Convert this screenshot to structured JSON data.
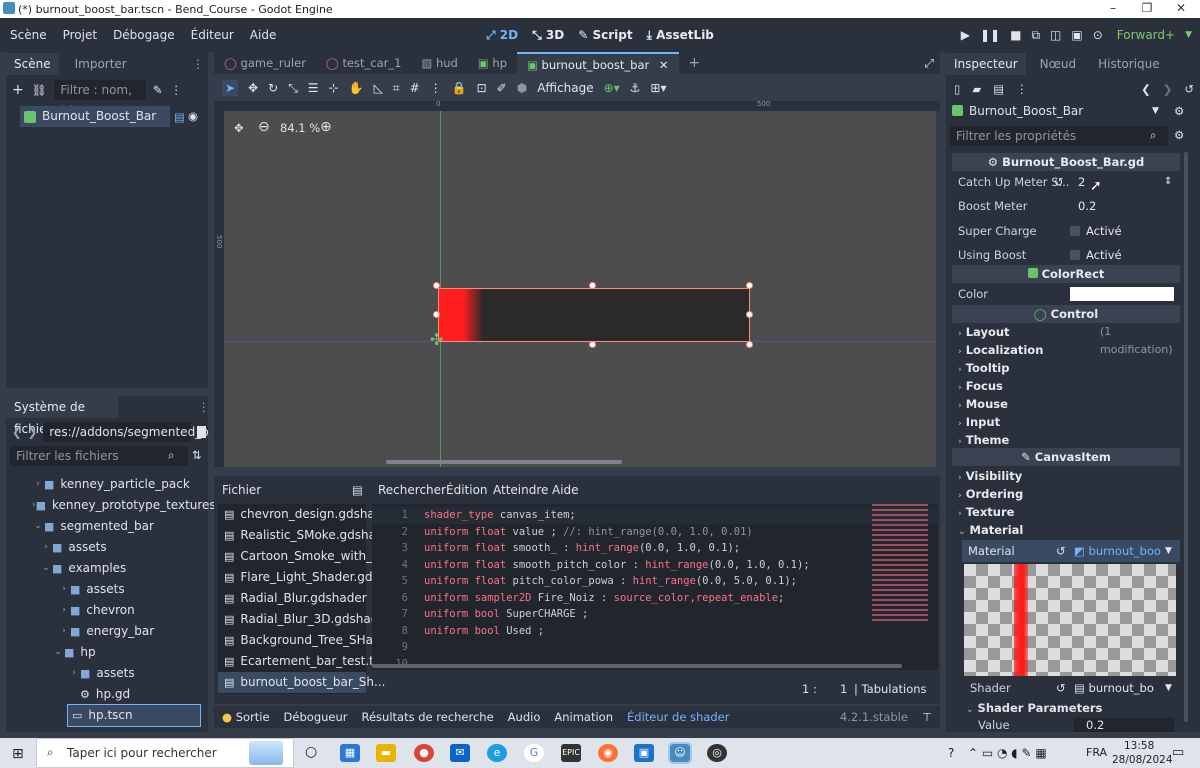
{
  "window": {
    "title": "(*) burnout_boost_bar.tscn - Bend_Course - Godot Engine",
    "controls": [
      "–",
      "❐",
      "✕"
    ]
  },
  "menu": {
    "items": [
      "Scène",
      "Projet",
      "Débogage",
      "Éditeur",
      "Aide"
    ],
    "modes": [
      "2D",
      "3D",
      "Script",
      "AssetLib"
    ],
    "renderer": "Forward+"
  },
  "scene_dock": {
    "tabs": [
      "Scène",
      "Importer"
    ],
    "filter_placeholder": "Filtre : nom, t:ty",
    "root_node": "Burnout_Boost_Bar"
  },
  "filesystem": {
    "title": "Système de fichiers",
    "path": "res://addons/segmented_b",
    "filter_placeholder": "Filtrer les fichiers",
    "items": [
      {
        "label": "kenney_particle_pack",
        "kind": "folder",
        "depth": 0
      },
      {
        "label": "kenney_prototype_textures",
        "kind": "folder",
        "depth": 0
      },
      {
        "label": "segmented_bar",
        "kind": "folder-open",
        "depth": 0
      },
      {
        "label": "assets",
        "kind": "folder",
        "depth": 1
      },
      {
        "label": "examples",
        "kind": "folder-open",
        "depth": 1
      },
      {
        "label": "assets",
        "kind": "folder",
        "depth": 2
      },
      {
        "label": "chevron",
        "kind": "folder",
        "depth": 2
      },
      {
        "label": "energy_bar",
        "kind": "folder",
        "depth": 2
      },
      {
        "label": "hp",
        "kind": "folder-open",
        "depth": 2
      },
      {
        "label": "assets",
        "kind": "folder",
        "depth": 3
      },
      {
        "label": "hp.gd",
        "kind": "gear",
        "depth": 3
      },
      {
        "label": "hp.tscn",
        "kind": "scene",
        "depth": 3,
        "selected": true
      }
    ]
  },
  "editor_tabs": {
    "tabs": [
      "game_ruler",
      "test_car_1",
      "hud",
      "hp",
      "burnout_boost_bar"
    ],
    "active": 4
  },
  "toolbar": {
    "view_label": "Affichage"
  },
  "viewport": {
    "zoom": "84.1 %",
    "ruler_ticks": [
      "0",
      "500"
    ],
    "ruler_v": "500"
  },
  "bottom": {
    "files_header": "Fichier",
    "search_menu": [
      "Rechercher",
      "Édition",
      "Atteindre",
      "Aide"
    ],
    "files": [
      "chevron_design.gdsha...",
      "Realistic_SMoke.gdsha...",
      "Cartoon_Smoke_with_fi...",
      "Flare_Light_Shader.gds...",
      "Radial_Blur.gdshader",
      "Radial_Blur_3D.gdshader",
      "Background_Tree_SHad...",
      "Ecartement_bar_test.tres",
      "burnout_boost_bar_Sh..."
    ],
    "status_line": "1 :",
    "status_col": "1",
    "status_indent": "Tabulations",
    "panels": [
      "Sortie",
      "Débogueur",
      "Résultats de recherche",
      "Audio",
      "Animation",
      "Éditeur de shader"
    ],
    "version": "4.2.1.stable"
  },
  "code": {
    "l1_kw": "shader_type",
    "l1_rest": " canvas_item;",
    "l2_kw": "uniform",
    "l2_ty": " float",
    "l2_rest": " value ; ",
    "l2_cm": "//: hint_range(0.0, 1.0, 0.01)",
    "l3_kw": "uniform",
    "l3_ty": " float",
    "l3_rest": " smooth_ : ",
    "l3_hn": "hint_range",
    "l3_args": "(0.0, 1.0, 0.1);",
    "l4_kw": "uniform",
    "l4_ty": " float",
    "l4_rest": " smooth_pitch_color : ",
    "l4_hn": "hint_range",
    "l4_args": "(0.0, 1.0, 0.1);",
    "l5_kw": "uniform",
    "l5_ty": " float",
    "l5_rest": " pitch_color_powa : ",
    "l5_hn": "hint_range",
    "l5_args": "(0.0, 5.0, 0.1);",
    "l6_kw": "uniform",
    "l6_ty": " sampler2D",
    "l6_rest": " Fire_Noiz : ",
    "l6_hn": "source_color,repeat_enable",
    "l6_end": ";",
    "l7_kw": "uniform",
    "l7_ty": " bool",
    "l7_rest": " SuperCHARGE ;",
    "l8_kw": "uniform",
    "l8_ty": " bool",
    "l8_rest": " Used ;",
    "line_numbers": [
      "1",
      "2",
      "3",
      "4",
      "5",
      "6",
      "7",
      "8",
      "9",
      "10"
    ]
  },
  "inspector": {
    "tabs": [
      "Inspecteur",
      "Nœud",
      "Historique"
    ],
    "object": "Burnout_Boost_Bar",
    "filter_placeholder": "Filtrer les propriétés",
    "script_header": "Burnout_Boost_Bar.gd",
    "props": [
      {
        "label": "Catch Up Meter S...",
        "value": "2"
      },
      {
        "label": "Boost Meter",
        "value": "0.2"
      },
      {
        "label": "Super Charge",
        "value": "Activé"
      },
      {
        "label": "Using Boost",
        "value": "Activé"
      }
    ],
    "colorrect_header": "ColorRect",
    "color_label": "Color",
    "control_header": "Control",
    "control_sections": [
      "Layout",
      "Localization",
      "Tooltip",
      "Focus",
      "Mouse",
      "Input",
      "Theme"
    ],
    "layout_note": "(1 modification)",
    "canvasitem_header": "CanvasItem",
    "canvas_sections": [
      "Visibility",
      "Ordering",
      "Texture",
      "Material"
    ],
    "material_label": "Material",
    "material_value": "burnout_boo",
    "shader_label": "Shader",
    "shader_value": "burnout_bo",
    "shader_params": "Shader Parameters",
    "value_label": "Value",
    "value_val": "0.2"
  },
  "taskbar": {
    "search_placeholder": "Taper ici pour rechercher",
    "lang": "FRA",
    "time": "13:58",
    "date": "28/08/2024"
  },
  "colors": {
    "accent": "#6eb4ff",
    "bar_fill": "#ff1e1e",
    "bar_bg": "#2a2a2a"
  }
}
